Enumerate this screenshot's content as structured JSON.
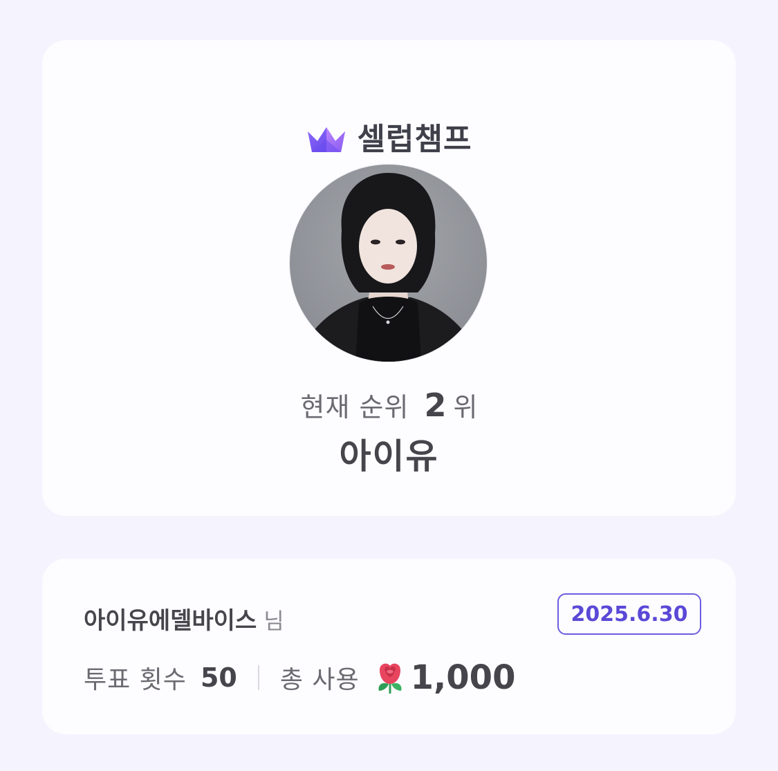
{
  "brand": {
    "name": "셀럽챔프",
    "icon": "crown-icon"
  },
  "profile": {
    "rank_label": "현재 순위",
    "rank_number": "2",
    "rank_unit": "위",
    "artist_name": "아이유"
  },
  "vote": {
    "user_name": "아이유에델바이스",
    "user_suffix": "님",
    "date": "2025.6.30",
    "vote_count_label": "투표 횟수",
    "vote_count": "50",
    "total_used_label": "총 사용",
    "total_icon": "rose-icon",
    "total_used": "1,000"
  },
  "colors": {
    "background": "#f5f3fd",
    "card": "#fdfcff",
    "accent": "#5a49d6",
    "crown_left": "#7b5cf0",
    "crown_right": "#a06bf4"
  }
}
